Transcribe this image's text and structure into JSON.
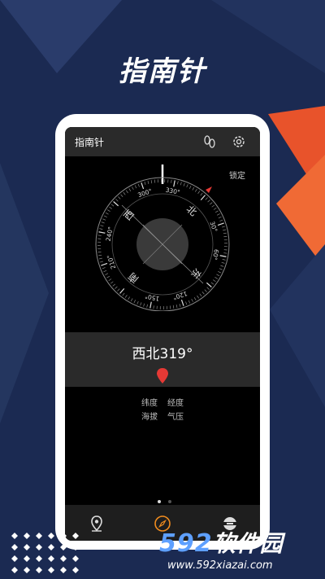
{
  "promo": {
    "title": "指南针"
  },
  "appbar": {
    "title": "指南针",
    "lock_label": "锁定"
  },
  "compass": {
    "heading_deg": 319,
    "ring_labels": [
      "330°",
      "300°",
      "240°",
      "210°",
      "150°",
      "120°",
      "60°",
      "30°"
    ],
    "cardinals": {
      "north": "北",
      "east": "东",
      "south": "南",
      "west": "西"
    }
  },
  "reading": {
    "text": "西北319°"
  },
  "info": {
    "latitude": "纬度",
    "longitude": "经度",
    "altitude": "海拔",
    "pressure": "气压"
  },
  "pager": {
    "count": 2,
    "active": 1
  },
  "watermark": {
    "brand_num": "592",
    "brand_cn": "软件园",
    "url": "www.592xiazai.com"
  },
  "colors": {
    "accent": "#e8532b",
    "pin": "#e53935",
    "nav_active": "#f08c1e",
    "bg": "#1b2a52"
  }
}
